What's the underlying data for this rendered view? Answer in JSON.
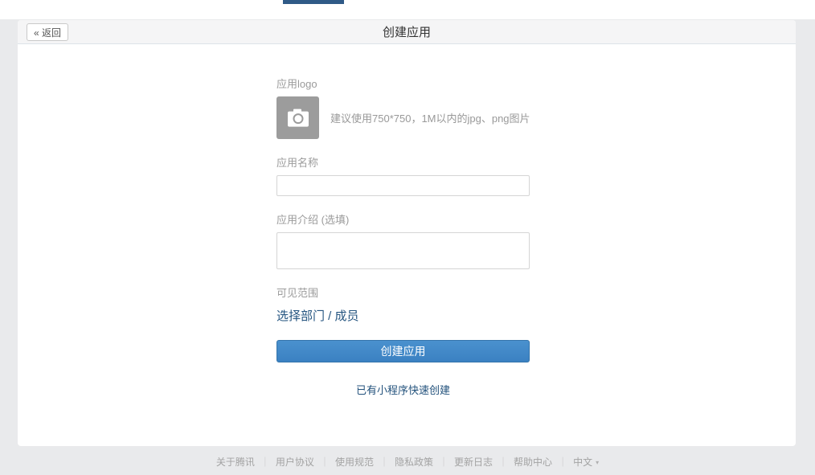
{
  "page": {
    "header": {
      "back_label": "« 返回",
      "title": "创建应用"
    },
    "form": {
      "logo": {
        "label": "应用logo",
        "hint": "建议使用750*750，1M以内的jpg、png图片",
        "icon": "camera-icon"
      },
      "name": {
        "label": "应用名称",
        "value": "",
        "placeholder": ""
      },
      "intro": {
        "label": "应用介绍 (选填)",
        "value": "",
        "placeholder": ""
      },
      "visibility": {
        "label": "可见范围",
        "select_link": "选择部门 / 成员"
      },
      "submit_label": "创建应用",
      "quick_create_link": "已有小程序快速创建"
    },
    "footer": {
      "links": [
        "关于腾讯",
        "用户协议",
        "使用规范",
        "隐私政策",
        "更新日志",
        "帮助中心"
      ],
      "separator": "｜",
      "language": {
        "label": "中文",
        "caret": "▾"
      }
    },
    "colors": {
      "accent_blue": "#3e86c5",
      "link_blue": "#23527c",
      "tab_indicator": "#2f5a87",
      "page_background": "#e9eaec",
      "header_background": "#f5f5f6"
    }
  }
}
